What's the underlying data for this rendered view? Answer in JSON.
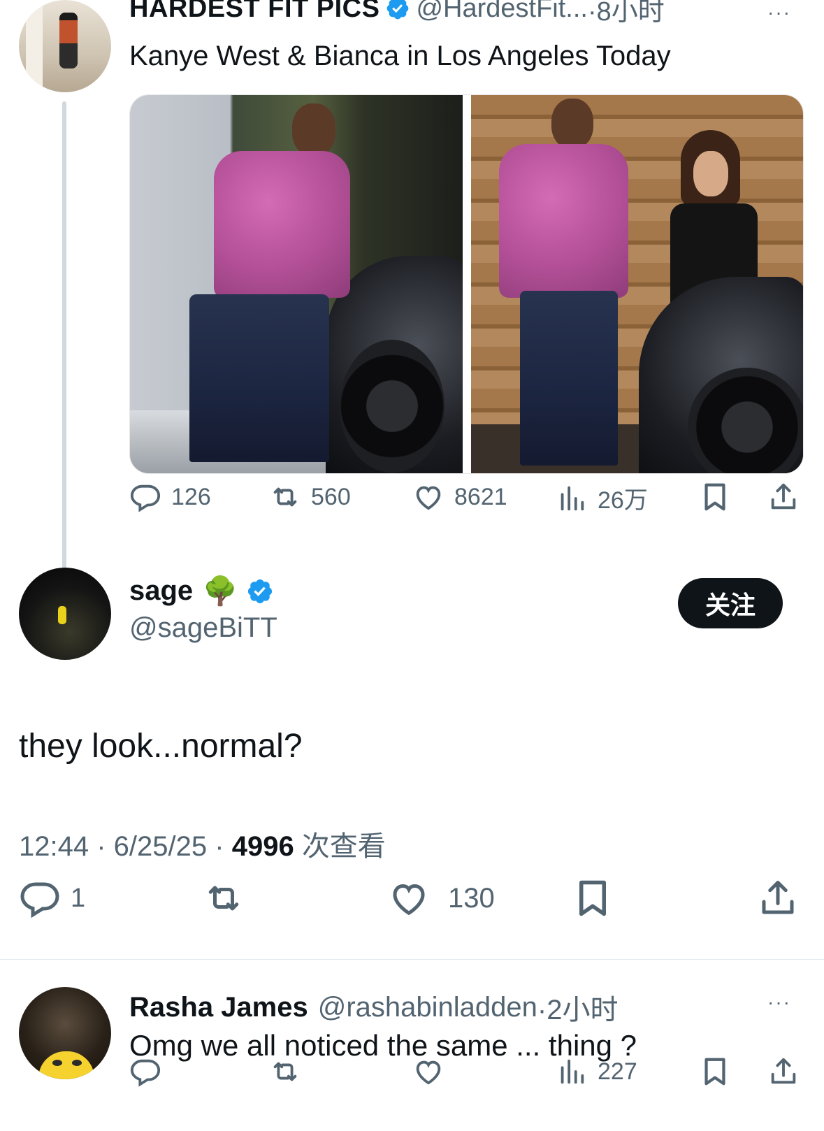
{
  "parent_tweet": {
    "author_name": "HARDEST FIT PICS",
    "handle": "@HardestFit...",
    "time": "·8小时",
    "text": "Kanye West & Bianca in Los Angeles Today",
    "more": "···",
    "stats": {
      "replies": "126",
      "reposts": "560",
      "likes": "8621",
      "views": "26万"
    }
  },
  "main_tweet": {
    "author_name": "sage",
    "author_emoji": "🌳",
    "handle": "@sageBiTT",
    "follow_label": "关注",
    "text": "they look...normal?",
    "time": "12:44",
    "date": "6/25/25",
    "view_count": "4996",
    "view_label": "次查看",
    "stats": {
      "replies": "1",
      "likes": "130"
    }
  },
  "reply_tweet": {
    "author_name": "Rasha James",
    "handle": "@rashabinladden",
    "time": "·2小时",
    "text": "Omg we all noticed the same ... thing ?",
    "more": "···",
    "stats": {
      "views": "227"
    }
  },
  "colors": {
    "text": "#0f1419",
    "secondary": "#536471",
    "verified": "#1d9bf0",
    "thread_line": "#cfd9de",
    "follow_button": "#0f1419"
  }
}
